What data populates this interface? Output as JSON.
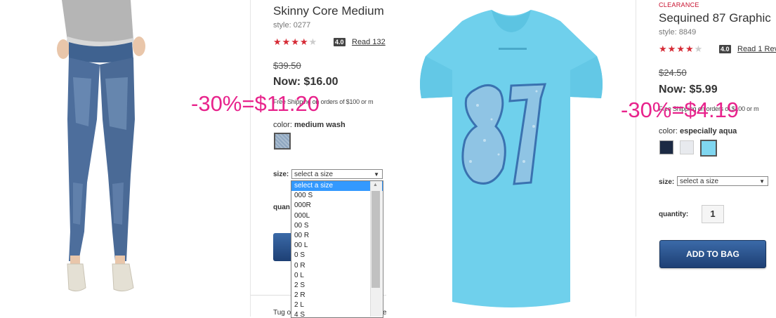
{
  "product1": {
    "title": "Skinny Core Medium",
    "style": "style: 0277",
    "rating": "4.0",
    "reviews": "Read 132",
    "old_price": "$39.50",
    "now_price": "Now: $16.00",
    "free_shipping": "Free Shipping on orders of $100 or m",
    "color_label": "color:",
    "color_value": "medium wash",
    "size_label": "size:",
    "size_placeholder": "select a size",
    "quantity_label": "quan",
    "size_options": [
      "select a size",
      "000 S",
      "000R",
      "000L",
      "00 S",
      "00 R",
      "00 L",
      "0 S",
      "0 R",
      "0 L",
      "2 S",
      "2 R",
      "2 L",
      "4 S"
    ],
    "footer_text": "Tug o",
    "footer_text2": "e"
  },
  "product2": {
    "badge": "CLEARANCE",
    "title": "Sequined 87 Graphic",
    "style": "style: 8849",
    "rating": "4.0",
    "reviews": "Read 1 Rev",
    "old_price": "$24.50",
    "now_price": "Now: $5.99",
    "free_shipping": "Free Shipping on orders of $100 or m",
    "color_label": "color:",
    "color_value": "especially aqua",
    "swatch_colors": [
      "#1c2a44",
      "#e8eaee",
      "#7fd6f0"
    ],
    "size_label": "size:",
    "size_placeholder": "select a size",
    "quantity_label": "quantity:",
    "quantity_value": "1",
    "add_to_bag": "ADD TO BAG"
  },
  "overlays": {
    "left": "-30%=$11.20",
    "right": "-30%=$4.19"
  },
  "colors": {
    "star_red": "#d62b36",
    "overlay_pink": "#e8238c",
    "tee_blue": "#6fd0ec",
    "denim": "#4a6a96",
    "button_blue": "#1d3f74",
    "selected_option": "#3399ff"
  },
  "icons": [
    "star-icon",
    "dropdown-arrow-icon",
    "scroll-up-icon"
  ]
}
